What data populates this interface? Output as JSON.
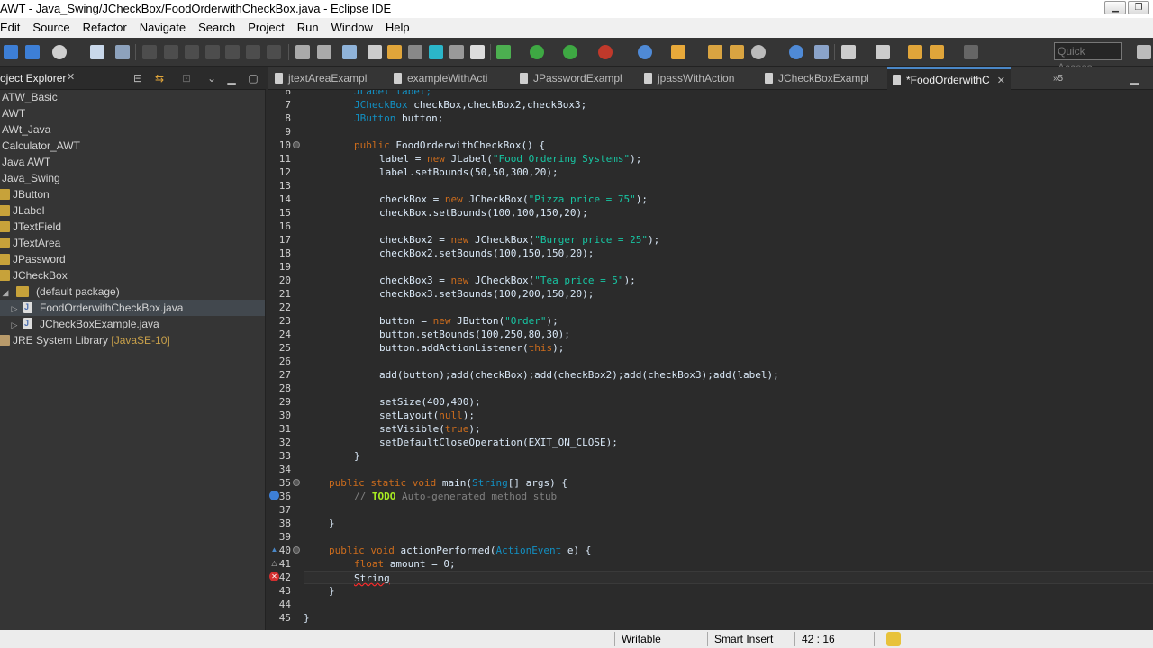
{
  "window": {
    "title": "AWT - Java_Swing/JCheckBox/FoodOrderwithCheckBox.java - Eclipse IDE"
  },
  "menu": [
    "Edit",
    "Source",
    "Refactor",
    "Navigate",
    "Search",
    "Project",
    "Run",
    "Window",
    "Help"
  ],
  "toolbar": {
    "quick_access_placeholder": "Quick Access"
  },
  "explorer": {
    "title": "oject Explorer",
    "items": [
      "ATW_Basic",
      "AWT",
      "AWt_Java",
      "Calculator_AWT",
      "Java AWT",
      "Java_Swing",
      "JButton",
      "JLabel",
      "JTextField",
      "JTextArea",
      "JPassword",
      "JCheckBox",
      "(default package)",
      "FoodOrderwithCheckBox.java",
      "JCheckBoxExample.java"
    ],
    "jre_label": "JRE System Library",
    "jre_version": "[JavaSE-10]"
  },
  "tabs": [
    "jtextAreaExampl",
    "exampleWithActi",
    "JPasswordExampl",
    "jpassWithAction",
    "JCheckBoxExampl",
    "*FoodOrderwithC"
  ],
  "tabs_overflow": "»5",
  "code": {
    "line_numbers": [
      "6",
      "7",
      "8",
      "9",
      "10",
      "11",
      "12",
      "13",
      "14",
      "15",
      "16",
      "17",
      "18",
      "19",
      "20",
      "21",
      "22",
      "23",
      "24",
      "25",
      "26",
      "27",
      "28",
      "29",
      "30",
      "31",
      "32",
      "33",
      "34",
      "35",
      "36",
      "37",
      "38",
      "39",
      "40",
      "41",
      "42",
      "43",
      "44",
      "45"
    ],
    "lines": {
      "l6": "JLabel label;",
      "l7": "JCheckBox checkBox,checkBox2,checkBox3;",
      "l8": "JButton button;",
      "l10a": "public",
      "l10b": " FoodOrderwithCheckBox() {",
      "l11a": "label = ",
      "l11b": "new",
      "l11c": " JLabel(",
      "l11d": "\"Food Ordering Systems\"",
      "l11e": ");",
      "l12": "label.setBounds(50,50,300,20);",
      "l14a": "checkBox = ",
      "l14b": "new",
      "l14c": " JCheckBox(",
      "l14d": "\"Pizza price = 75\"",
      "l14e": ");",
      "l15": "checkBox.setBounds(100,100,150,20);",
      "l17a": "checkBox2 = ",
      "l17b": "new",
      "l17c": " JCheckBox(",
      "l17d": "\"Burger price = 25\"",
      "l17e": ");",
      "l18": "checkBox2.setBounds(100,150,150,20);",
      "l20a": "checkBox3 = ",
      "l20b": "new",
      "l20c": " JCheckBox(",
      "l20d": "\"Tea price = 5\"",
      "l20e": ");",
      "l21": "checkBox3.setBounds(100,200,150,20);",
      "l23a": "button = ",
      "l23b": "new",
      "l23c": " JButton(",
      "l23d": "\"Order\"",
      "l23e": ");",
      "l24": "button.setBounds(100,250,80,30);",
      "l25a": "button.addActionListener(",
      "l25b": "this",
      "l25c": ");",
      "l27": "add(button);add(checkBox);add(checkBox2);add(checkBox3);add(label);",
      "l29": "setSize(400,400);",
      "l30a": "setLayout(",
      "l30b": "null",
      "l30c": ");",
      "l31a": "setVisible(",
      "l31b": "true",
      "l31c": ");",
      "l32": "setDefaultCloseOperation(EXIT_ON_CLOSE);",
      "l33": "}",
      "l35a": "public static void",
      "l35b": " main(",
      "l35c": "String",
      "l35d": "[] args) {",
      "l36a": "// ",
      "l36b": "TODO",
      "l36c": " Auto-generated method stub",
      "l38": "}",
      "l40a": "public void",
      "l40b": " actionPerformed(",
      "l40c": "ActionEvent",
      "l40d": " e) {",
      "l41a": "float",
      "l41b": " amount = 0;",
      "l42": "String",
      "l43": "}",
      "l45": "}"
    }
  },
  "status": {
    "mode": "Writable",
    "insert": "Smart Insert",
    "position": "42 : 16"
  },
  "colors": {
    "editor_bg": "#2b2b2b",
    "keyword": "#cc6c1d",
    "string": "#17c6a3",
    "type": "#1290c3",
    "error": "#ff2a2a"
  }
}
